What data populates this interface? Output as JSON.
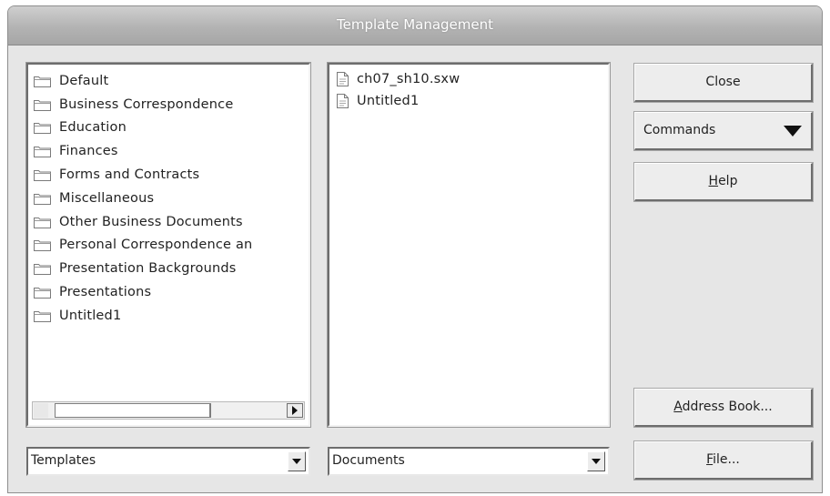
{
  "window": {
    "title": "Template Management"
  },
  "categories": [
    "Default",
    "Business Correspondence",
    "Education",
    "Finances",
    "Forms and Contracts",
    "Miscellaneous",
    "Other Business Documents",
    "Personal Correspondence an",
    "Presentation Backgrounds",
    "Presentations",
    "Untitled1"
  ],
  "documents": [
    "ch07_sh10.sxw",
    "Untitled1"
  ],
  "buttons": {
    "close": "Close",
    "commands": "Commands",
    "help_mnemonic": "H",
    "help_rest": "elp",
    "address_book_mnemonic": "A",
    "address_book_rest": "ddress Book...",
    "file_mnemonic": "F",
    "file_rest": "ile..."
  },
  "selectors": {
    "left": "Templates",
    "right": "Documents"
  }
}
